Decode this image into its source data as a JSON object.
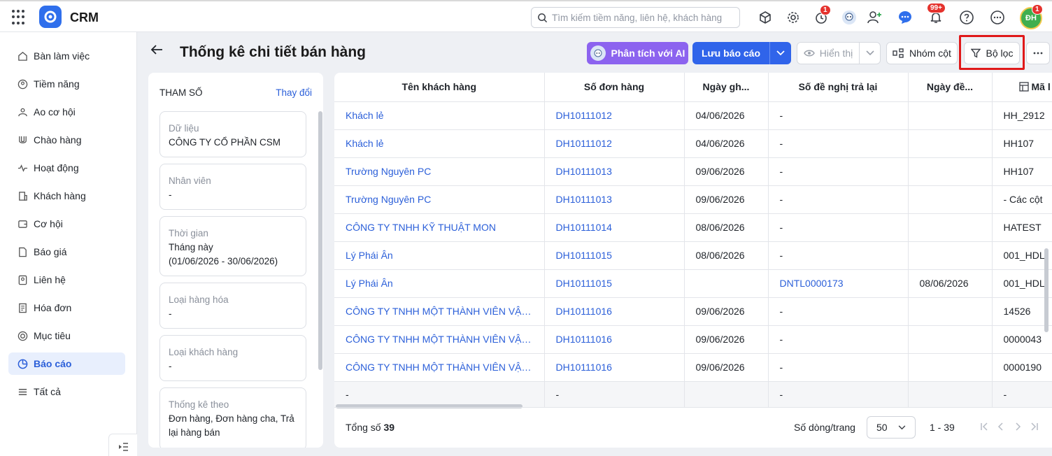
{
  "app": {
    "name": "CRM"
  },
  "topbar": {
    "search_placeholder": "Tìm kiếm tiềm năng, liên hệ, khách hàng",
    "badges": {
      "reminder": "1",
      "notifications": "99+",
      "avatar": "1"
    },
    "avatar_initials": "ĐH",
    "icons": [
      "app-grid-icon",
      "cube-icon",
      "gear-icon",
      "timer-icon",
      "robot-icon",
      "add-user-icon",
      "chat-icon",
      "bell-icon",
      "help-icon",
      "more-icon"
    ]
  },
  "sidebar": {
    "items": [
      {
        "label": "Bàn làm việc",
        "icon": "home-icon"
      },
      {
        "label": "Tiềm năng",
        "icon": "target-user-icon"
      },
      {
        "label": "Ao cơ hội",
        "icon": "pool-icon"
      },
      {
        "label": "Chào hàng",
        "icon": "magnet-icon"
      },
      {
        "label": "Hoạt động",
        "icon": "activity-icon"
      },
      {
        "label": "Khách hàng",
        "icon": "building-icon"
      },
      {
        "label": "Cơ hội",
        "icon": "wallet-icon"
      },
      {
        "label": "Báo giá",
        "icon": "quote-icon"
      },
      {
        "label": "Liên hệ",
        "icon": "contact-icon"
      },
      {
        "label": "Hóa đơn",
        "icon": "invoice-icon"
      },
      {
        "label": "Mục tiêu",
        "icon": "goal-icon"
      },
      {
        "label": "Báo cáo",
        "icon": "report-icon",
        "active": true
      },
      {
        "label": "Tất cả",
        "icon": "menu-icon"
      }
    ]
  },
  "header": {
    "title": "Thống kê chi tiết bán hàng",
    "ai_button": "Phân tích với AI",
    "save_button": "Lưu báo cáo",
    "view_button": "Hiển thị",
    "group_button": "Nhóm cột",
    "filter_button": "Bộ lọc"
  },
  "params": {
    "heading": "THAM SỐ",
    "change_link": "Thay đổi",
    "cards": [
      {
        "label": "Dữ liệu",
        "value": "CÔNG TY CỔ PHẦN CSM"
      },
      {
        "label": "Nhân viên",
        "value": "-"
      },
      {
        "label": "Thời gian",
        "value": "Tháng này",
        "value2": "(01/06/2026 - 30/06/2026)"
      },
      {
        "label": "Loại hàng hóa",
        "value": "-"
      },
      {
        "label": "Loại khách hàng",
        "value": "-"
      },
      {
        "label": "Thống kê theo",
        "value": "Đơn hàng, Đơn hàng cha, Trả",
        "value2": "lại hàng bán"
      }
    ]
  },
  "table": {
    "columns": [
      "Tên khách hàng",
      "Số đơn hàng",
      "Ngày gh...",
      "Số đề nghị trả lại",
      "Ngày đề...",
      "Mã l"
    ],
    "rows": [
      [
        "Khách lẻ",
        "DH10111012",
        "04/06/2026",
        "-",
        "",
        "HH_2912"
      ],
      [
        "Khách lẻ",
        "DH10111012",
        "04/06/2026",
        "-",
        "",
        "HH107"
      ],
      [
        "Trường Nguyên PC",
        "DH10111013",
        "09/06/2026",
        "-",
        "",
        "HH107"
      ],
      [
        "Trường Nguyên PC",
        "DH10111013",
        "09/06/2026",
        "-",
        "",
        "- Các cột"
      ],
      [
        "CÔNG TY TNHH KỸ THUẬT MON",
        "DH10111014",
        "08/06/2026",
        "-",
        "",
        "HATEST"
      ],
      [
        "Lý Phái Ân",
        "DH10111015",
        "08/06/2026",
        "-",
        "",
        "001_HDL"
      ],
      [
        "Lý Phái Ân",
        "DH10111015",
        "",
        "DNTL0000173",
        "08/06/2026",
        "001_HDL"
      ],
      [
        "CÔNG TY TNHH MỘT THÀNH VIÊN VẬN ...",
        "DH10111016",
        "09/06/2026",
        "-",
        "",
        "14526"
      ],
      [
        "CÔNG TY TNHH MỘT THÀNH VIÊN VẬN ...",
        "DH10111016",
        "09/06/2026",
        "-",
        "",
        "0000043"
      ],
      [
        "CÔNG TY TNHH MỘT THÀNH VIÊN VẬN ...",
        "DH10111016",
        "09/06/2026",
        "-",
        "",
        "0000190"
      ]
    ],
    "total_row": [
      "-",
      "-",
      "",
      "-",
      "",
      "-"
    ]
  },
  "footer": {
    "total_label": "Tổng số",
    "total_value": "39",
    "per_page_label": "Số dòng/trang",
    "per_page_value": "50",
    "range": "1 - 39"
  },
  "colors": {
    "primary": "#3064ea",
    "ai": "#8c63ef",
    "link": "#2b5fd9",
    "highlight": "#e0191a",
    "badge": "#e5322d"
  }
}
